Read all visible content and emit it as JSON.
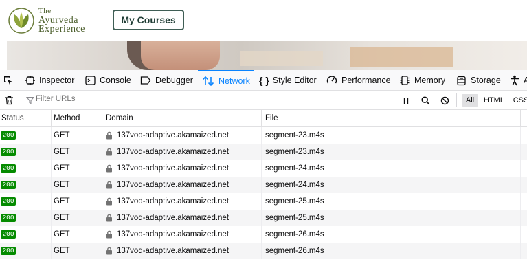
{
  "site": {
    "logo_line1": "The",
    "logo_line2": "Ayurveda",
    "logo_line3": "Experience",
    "my_courses_label": "My Courses"
  },
  "devtools": {
    "tabs": [
      {
        "label": "Inspector",
        "icon": "inspector-icon"
      },
      {
        "label": "Console",
        "icon": "console-icon"
      },
      {
        "label": "Debugger",
        "icon": "debugger-icon"
      },
      {
        "label": "Network",
        "icon": "network-icon",
        "active": true
      },
      {
        "label": "Style Editor",
        "icon": "style-editor-icon"
      },
      {
        "label": "Performance",
        "icon": "performance-icon"
      },
      {
        "label": "Memory",
        "icon": "memory-icon"
      },
      {
        "label": "Storage",
        "icon": "storage-icon"
      },
      {
        "label": "A",
        "icon": "accessibility-icon"
      }
    ],
    "filter_placeholder": "Filter URLs",
    "filter_buttons": {
      "all": "All",
      "html": "HTML",
      "css": "CSS"
    },
    "accent_color": "#0a84ff",
    "columns": {
      "status": "Status",
      "method": "Method",
      "domain": "Domain",
      "file": "File"
    },
    "rows": [
      {
        "status": "200",
        "method": "GET",
        "domain": "137vod-adaptive.akamaized.net",
        "file": "segment-23.m4s"
      },
      {
        "status": "200",
        "method": "GET",
        "domain": "137vod-adaptive.akamaized.net",
        "file": "segment-23.m4s"
      },
      {
        "status": "200",
        "method": "GET",
        "domain": "137vod-adaptive.akamaized.net",
        "file": "segment-24.m4s"
      },
      {
        "status": "200",
        "method": "GET",
        "domain": "137vod-adaptive.akamaized.net",
        "file": "segment-24.m4s"
      },
      {
        "status": "200",
        "method": "GET",
        "domain": "137vod-adaptive.akamaized.net",
        "file": "segment-25.m4s"
      },
      {
        "status": "200",
        "method": "GET",
        "domain": "137vod-adaptive.akamaized.net",
        "file": "segment-25.m4s"
      },
      {
        "status": "200",
        "method": "GET",
        "domain": "137vod-adaptive.akamaized.net",
        "file": "segment-26.m4s"
      },
      {
        "status": "200",
        "method": "GET",
        "domain": "137vod-adaptive.akamaized.net",
        "file": "segment-26.m4s"
      }
    ],
    "status_color": "#058b00"
  }
}
